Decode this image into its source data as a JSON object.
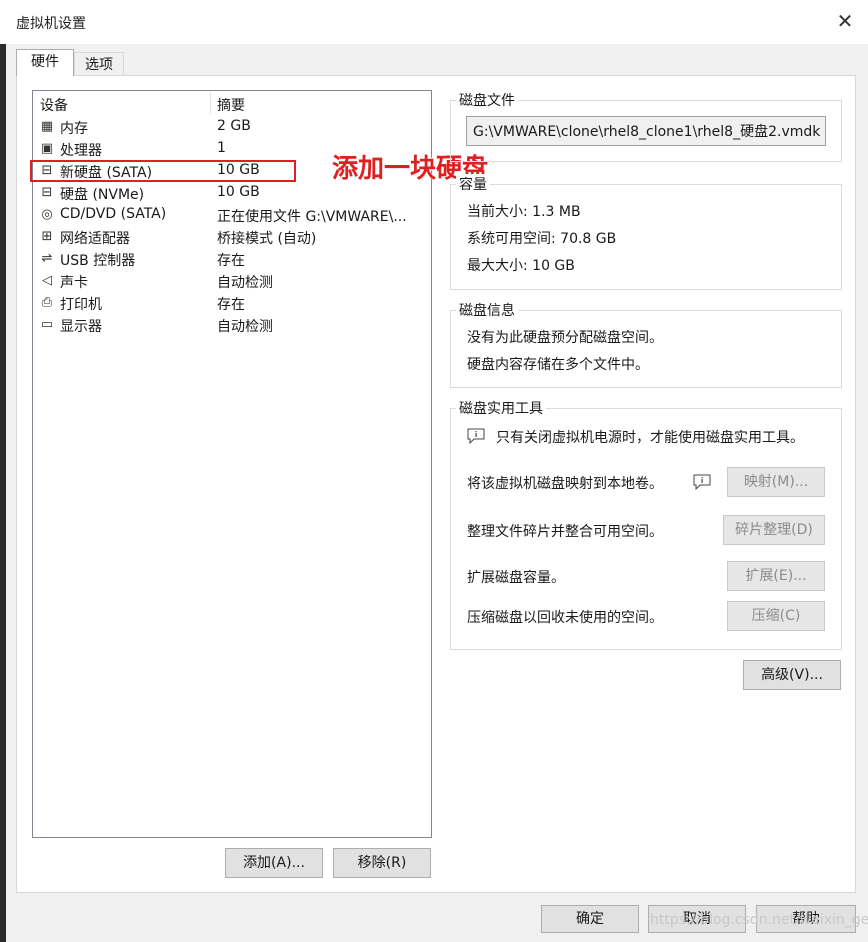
{
  "window": {
    "title": "虚拟机设置",
    "close_glyph": "✕"
  },
  "tabs": [
    {
      "label": "硬件"
    },
    {
      "label": "选项"
    }
  ],
  "device_list": {
    "header_device": "设备",
    "header_summary": "摘要",
    "rows": [
      {
        "icon": "memory-icon",
        "glyph": "▦",
        "name": "内存",
        "summary": "2 GB"
      },
      {
        "icon": "processor-icon",
        "glyph": "▣",
        "name": "处理器",
        "summary": "1"
      },
      {
        "icon": "hard-disk-icon",
        "glyph": "⊟",
        "name": "新硬盘 (SATA)",
        "summary": "10 GB"
      },
      {
        "icon": "hard-disk-icon",
        "glyph": "⊟",
        "name": "硬盘 (NVMe)",
        "summary": "10 GB"
      },
      {
        "icon": "cd-dvd-icon",
        "glyph": "◎",
        "name": "CD/DVD (SATA)",
        "summary": "正在使用文件 G:\\VMWARE\\..."
      },
      {
        "icon": "network-adapter-icon",
        "glyph": "⊞",
        "name": "网络适配器",
        "summary": "桥接模式 (自动)"
      },
      {
        "icon": "usb-icon",
        "glyph": "⇌",
        "name": "USB 控制器",
        "summary": "存在"
      },
      {
        "icon": "sound-card-icon",
        "glyph": "◁",
        "name": "声卡",
        "summary": "自动检测"
      },
      {
        "icon": "printer-icon",
        "glyph": "⎙",
        "name": "打印机",
        "summary": "存在"
      },
      {
        "icon": "display-icon",
        "glyph": "▭",
        "name": "显示器",
        "summary": "自动检测"
      }
    ]
  },
  "annotation": {
    "text": "添加一块硬盘",
    "color": "#e02020"
  },
  "list_buttons": {
    "add": "添加(A)...",
    "remove": "移除(R)"
  },
  "disk_file": {
    "label": "磁盘文件",
    "path": "G:\\VMWARE\\clone\\rhel8_clone1\\rhel8_硬盘2.vmdk"
  },
  "capacity": {
    "label": "容量",
    "current_size": "当前大小: 1.3 MB",
    "available_space": "系统可用空间: 70.8 GB",
    "max_size": "最大大小: 10 GB"
  },
  "disk_info": {
    "label": "磁盘信息",
    "line1": "没有为此硬盘预分配磁盘空间。",
    "line2": "硬盘内容存储在多个文件中。"
  },
  "disk_utilities": {
    "label": "磁盘实用工具",
    "notice": "只有关闭虚拟机电源时，才能使用磁盘实用工具。",
    "map_text": "将该虚拟机磁盘映射到本地卷。",
    "map_button": "映射(M)...",
    "defrag_text": "整理文件碎片并整合可用空间。",
    "defrag_button": "碎片整理(D)",
    "expand_text": "扩展磁盘容量。",
    "expand_button": "扩展(E)...",
    "compact_text": "压缩磁盘以回收未使用的空间。",
    "compact_button": "压缩(C)"
  },
  "advanced_button": "高级(V)...",
  "footer": {
    "ok": "确定",
    "cancel": "取消",
    "help": "帮助"
  },
  "watermark": "https://blog.csdn.net/weixin_gee_c"
}
